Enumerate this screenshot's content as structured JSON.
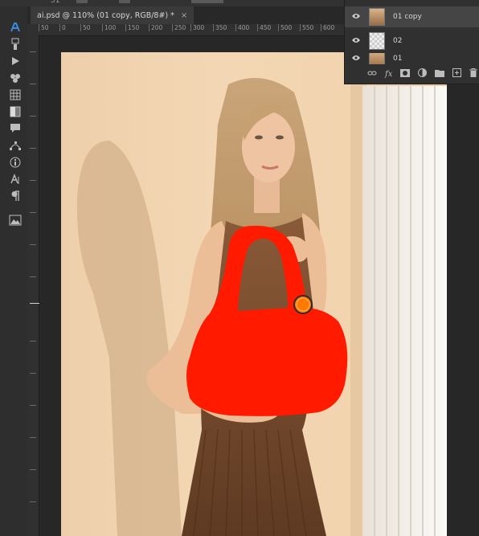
{
  "topbar": {
    "number": "51"
  },
  "document": {
    "tab_title": "ai.psd @ 110% (01 copy, RGB/8#) *",
    "close_glyph": "×"
  },
  "ruler": {
    "marks": [
      "50",
      "0",
      "50",
      "100",
      "150",
      "200",
      "250",
      "300",
      "350",
      "400",
      "450",
      "500",
      "550",
      "600"
    ]
  },
  "layers": {
    "items": [
      {
        "name": "01 copy",
        "visible": true,
        "selected": true
      },
      {
        "name": "02",
        "visible": true,
        "selected": false
      },
      {
        "name": "01",
        "visible": true,
        "selected": false
      }
    ],
    "footer_icons": [
      "link-icon",
      "fx-icon",
      "mask-icon",
      "adjustment-icon",
      "group-folder-icon",
      "new-layer-icon",
      "trash-icon"
    ],
    "fx_label": "fx"
  },
  "tools": [
    "ai-assistant-icon",
    "brush-preset-icon",
    "play-icon",
    "theme-icon",
    "table-icon",
    "gradient-icon",
    "comment-icon",
    "path-icon",
    "info-icon",
    "character-icon",
    "paragraph-icon",
    "image-icon"
  ],
  "colors": {
    "paint_red": "#ff1a00",
    "marker_orange": "#ff7a00",
    "accent_blue": "#3b8bdc"
  }
}
